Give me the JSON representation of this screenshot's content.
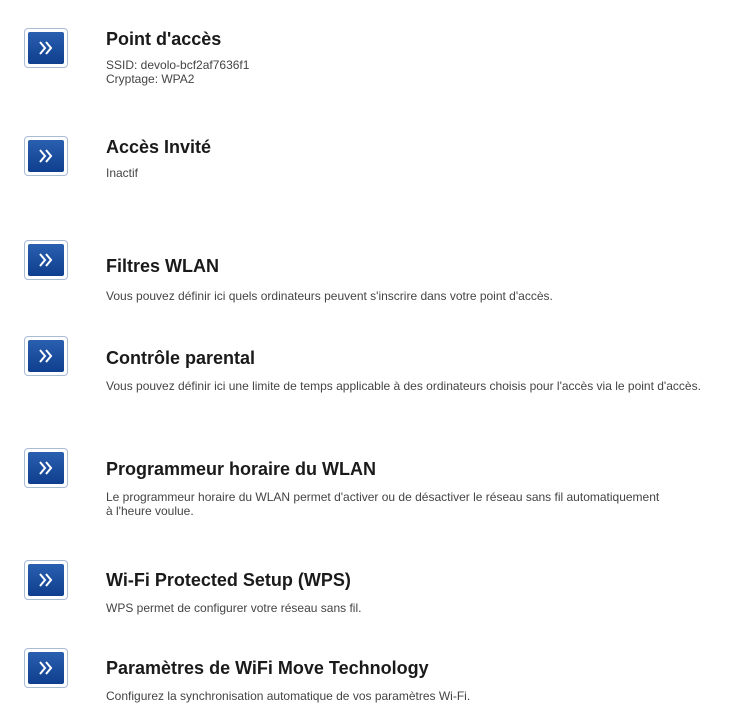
{
  "colors": {
    "button_border": "#a9bcd6",
    "button_fill": "#1f4f9e",
    "title_text": "#1a1a1a",
    "desc_text": "#444444"
  },
  "items": [
    {
      "title": "Point d'accès",
      "lines": [
        "SSID: devolo-bcf2af7636f1",
        "Cryptage: WPA2"
      ],
      "icon": "double-chevron-right-icon"
    },
    {
      "title": "Accès Invité",
      "lines": [
        "Inactif"
      ],
      "icon": "double-chevron-right-icon"
    },
    {
      "title": "Filtres WLAN",
      "lines": [
        "Vous pouvez définir ici quels ordinateurs peuvent s'inscrire dans votre point d'accès."
      ],
      "icon": "double-chevron-right-icon"
    },
    {
      "title": "Contrôle parental",
      "lines": [
        "Vous pouvez définir ici une limite de temps applicable à des ordinateurs choisis pour l'accès via le point d'accès."
      ],
      "icon": "double-chevron-right-icon"
    },
    {
      "title": "Programmeur horaire du WLAN",
      "lines": [
        "Le programmeur horaire du WLAN permet d'activer ou de désactiver le réseau sans fil automatiquement à l'heure voulue."
      ],
      "icon": "double-chevron-right-icon"
    },
    {
      "title": "Wi-Fi Protected Setup (WPS)",
      "lines": [
        "WPS permet de configurer votre réseau sans fil."
      ],
      "icon": "double-chevron-right-icon"
    },
    {
      "title": "Paramètres de WiFi Move Technology",
      "lines": [
        "Configurez la synchronisation automatique de vos paramètres Wi-Fi."
      ],
      "icon": "double-chevron-right-icon"
    }
  ]
}
